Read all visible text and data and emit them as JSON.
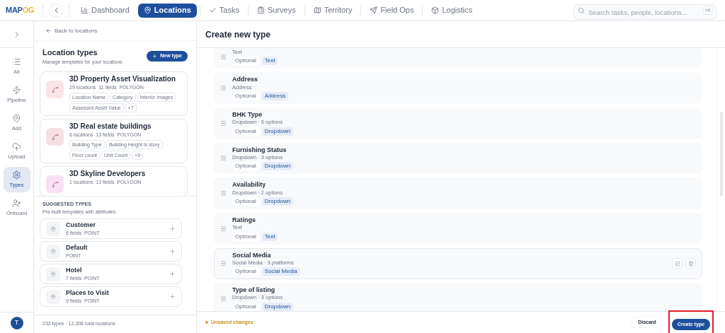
{
  "logo": {
    "main": "MAP",
    "accent": "OG"
  },
  "nav": [
    {
      "label": "Dashboard",
      "selected": false
    },
    {
      "label": "Locations",
      "selected": true
    },
    {
      "label": "Tasks",
      "selected": false
    },
    {
      "label": "Surveys",
      "selected": false
    },
    {
      "label": "Territory",
      "selected": false
    },
    {
      "label": "Field Ops",
      "selected": false
    },
    {
      "label": "Logistics",
      "selected": false
    }
  ],
  "search": {
    "placeholder": "Search tasks, people, locations...",
    "shortcut": "⌘K"
  },
  "rail": [
    {
      "label": "All",
      "selected": false
    },
    {
      "label": "Pipeline",
      "selected": false
    },
    {
      "label": "Add",
      "selected": false
    },
    {
      "label": "Upload",
      "selected": false
    },
    {
      "label": "Types",
      "selected": true
    },
    {
      "label": "Onboard",
      "selected": false
    }
  ],
  "avatar": "T",
  "panel": {
    "back": "Back to locations",
    "title": "Location types",
    "subtitle": "Manage templates for your locations",
    "new_button": "New type",
    "types": [
      {
        "name": "3D Property Asset Visualization",
        "meta": "29 locations  11 fields  POLYGON",
        "color": "#fbe4e6",
        "tags": [
          "Location Name",
          "Category",
          "Interior Images",
          "Assessed Asset Value",
          "+7"
        ]
      },
      {
        "name": "3D Real estate buildings",
        "meta": "6 locations  13 fields  POLYGON",
        "color": "#f3e0e2",
        "tags": [
          "Building Type",
          "Building Height in story",
          "Floor count",
          "Unit Count",
          "+9"
        ]
      },
      {
        "name": "3D Skyline Developers",
        "meta": "1 locations  13 fields  POLYGON",
        "color": "#fbe0f3"
      }
    ],
    "suggested_title": "SUGGESTED TYPES",
    "suggested_subtitle": "Pre-built templates with attributes",
    "suggested": [
      {
        "name": "Customer",
        "meta": "6 fields  POINT"
      },
      {
        "name": "Default",
        "meta": "POINT"
      },
      {
        "name": "Hotel",
        "meta": "7 fields  POINT"
      },
      {
        "name": "Places to Visit",
        "meta": "9 fields  POINT"
      }
    ],
    "footer": "232 types · 12,308 total locations"
  },
  "main": {
    "title": "Create new type",
    "fields": [
      {
        "detail": "Text",
        "required": "Optional",
        "type": "Text",
        "hovered": false
      },
      {
        "name": "Address",
        "detail": "Address",
        "required": "Optional",
        "type": "Address",
        "hovered": false
      },
      {
        "name": "BHK Type",
        "detail": "Dropdown · 5 options",
        "required": "Optional",
        "type": "Dropdown",
        "hovered": false
      },
      {
        "name": "Furnishing Status",
        "detail": "Dropdown · 3 options",
        "required": "Optional",
        "type": "Dropdown",
        "hovered": false
      },
      {
        "name": "Availability",
        "detail": "Dropdown · 2 options",
        "required": "Optional",
        "type": "Dropdown",
        "hovered": false
      },
      {
        "name": "Ratings",
        "detail": "Text",
        "required": "Optional",
        "type": "Text",
        "hovered": false
      },
      {
        "name": "Social Media",
        "detail": "Social Media · 3 platforms",
        "required": "Optional",
        "type": "Social Media",
        "hovered": true
      },
      {
        "name": "Type of listing",
        "detail": "Dropdown · 3 options",
        "required": "Optional",
        "type": "Dropdown",
        "hovered": false
      }
    ],
    "unsaved": "Unsaved changes",
    "discard": "Discard",
    "create": {
      "label": "Create type",
      "highlighted": true
    }
  }
}
